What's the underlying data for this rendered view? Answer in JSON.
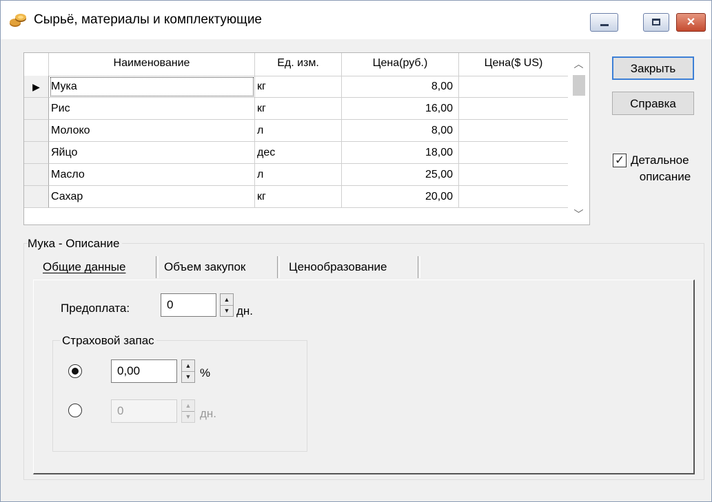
{
  "window": {
    "title": "Сырьё, материалы и комплектующие",
    "controls": {
      "minimize": "minimize",
      "maximize": "maximize",
      "close": "✕"
    }
  },
  "grid": {
    "columns": [
      "Наименование",
      "Ед. изм.",
      "Цена(руб.)",
      "Цена($ US)"
    ],
    "rows": [
      {
        "name": "Мука",
        "unit": "кг",
        "price_rub": "8,00",
        "price_usd": "",
        "current": true
      },
      {
        "name": "Рис",
        "unit": "кг",
        "price_rub": "16,00",
        "price_usd": ""
      },
      {
        "name": "Молоко",
        "unit": "л",
        "price_rub": "8,00",
        "price_usd": ""
      },
      {
        "name": "Яйцо",
        "unit": "дес",
        "price_rub": "18,00",
        "price_usd": ""
      },
      {
        "name": "Масло",
        "unit": "л",
        "price_rub": "25,00",
        "price_usd": ""
      },
      {
        "name": "Сахар",
        "unit": "кг",
        "price_rub": "20,00",
        "price_usd": ""
      }
    ],
    "row_indicator": "▶"
  },
  "buttons": {
    "close": "Закрыть",
    "help": "Справка"
  },
  "detail_checkbox": {
    "label_line1": "Детальное",
    "label_line2": "описание",
    "checked": true,
    "mark": "✓"
  },
  "description": {
    "group_label": "Мука - Описание",
    "tabs": [
      "Общие данные",
      "Объем закупок",
      "Ценообразование"
    ],
    "active_tab": 0,
    "prepay": {
      "label": "Предоплата:",
      "value": "0",
      "unit": "дн."
    },
    "insurance": {
      "label": "Страховой запас",
      "percent": {
        "value": "0,00",
        "unit": "%",
        "selected": true
      },
      "days": {
        "value": "0",
        "unit": "дн.",
        "selected": false
      }
    }
  },
  "colors": {
    "accent": "#3c7fd6",
    "close_button": "#c44a2f"
  }
}
